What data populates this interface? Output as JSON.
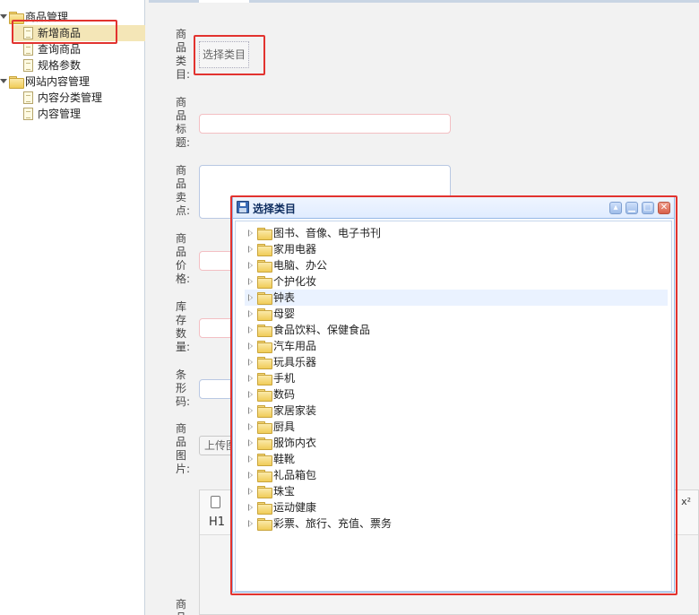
{
  "sidebar": {
    "groups": [
      {
        "label": "商品管理",
        "items": [
          {
            "label": "新增商品",
            "selected": true
          },
          {
            "label": "查询商品"
          },
          {
            "label": "规格参数"
          }
        ]
      },
      {
        "label": "网站内容管理",
        "items": [
          {
            "label": "内容分类管理"
          },
          {
            "label": "内容管理"
          }
        ]
      }
    ]
  },
  "form": {
    "labels": [
      "商品类目:",
      "商品标题:",
      "商品卖点:",
      "商品价格:",
      "库存数量:",
      "条形码:",
      "商品图片:",
      "商品"
    ],
    "category_button": "选择类目",
    "upload_button": "上传图片",
    "editor": {
      "heading_label": "H1",
      "superscript_label": "x²"
    }
  },
  "dialog": {
    "title": "选择类目",
    "categories": [
      "图书、音像、电子书刊",
      "家用电器",
      "电脑、办公",
      "个护化妆",
      "钟表",
      "母婴",
      "食品饮料、保健食品",
      "汽车用品",
      "玩具乐器",
      "手机",
      "数码",
      "家居家装",
      "厨具",
      "服饰内衣",
      "鞋靴",
      "礼品箱包",
      "珠宝",
      "运动健康",
      "彩票、旅行、充值、票务"
    ],
    "hovered_category": "钟表",
    "window_buttons": {
      "collapse": "▴",
      "minimize": "▁",
      "maximize": "□",
      "close": "✕"
    }
  }
}
